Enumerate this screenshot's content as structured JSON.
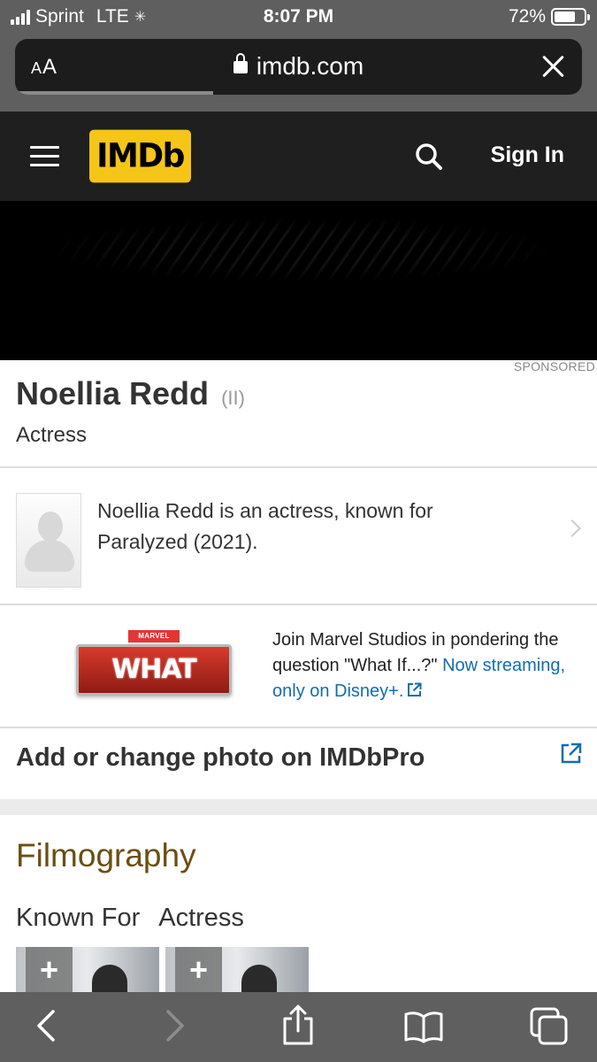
{
  "status": {
    "carrier": "Sprint",
    "network": "LTE",
    "time": "8:07 PM",
    "battery": "72%",
    "battery_level": 0.72
  },
  "browser": {
    "text_size_label": "AA",
    "url": "imdb.com",
    "load_progress": 0.35
  },
  "header": {
    "logo": "IMDb",
    "sign_in": "Sign In"
  },
  "ad": {
    "sponsored_label": "SPONSORED"
  },
  "person": {
    "name": "Noellia Redd",
    "roman_numeral": "(II)",
    "role": "Actress",
    "bio": "Noellia Redd is an actress, known for Paralyzed (2021)."
  },
  "promo": {
    "brand_label": "MARVEL STUDIOS",
    "logo_text": "WHAT IF...?",
    "text": "Join Marvel Studios in pondering the question \"What If...?\"",
    "link_text": "Now streaming, only on Disney+."
  },
  "imdbpro": {
    "label": "Add or change photo on IMDbPro"
  },
  "filmography": {
    "title": "Filmography",
    "tabs": [
      "Known For",
      "Actress"
    ],
    "add_label": "+"
  },
  "colors": {
    "imdb_yellow": "#f5c518",
    "link_blue": "#136cb2",
    "filmography_gold": "#6b4e12"
  },
  "icons": [
    "hamburger-icon",
    "search-icon",
    "lock-icon",
    "close-icon",
    "chevron-right-icon",
    "external-link-icon",
    "back-icon",
    "forward-icon",
    "share-icon",
    "bookmarks-icon",
    "tabs-icon"
  ]
}
